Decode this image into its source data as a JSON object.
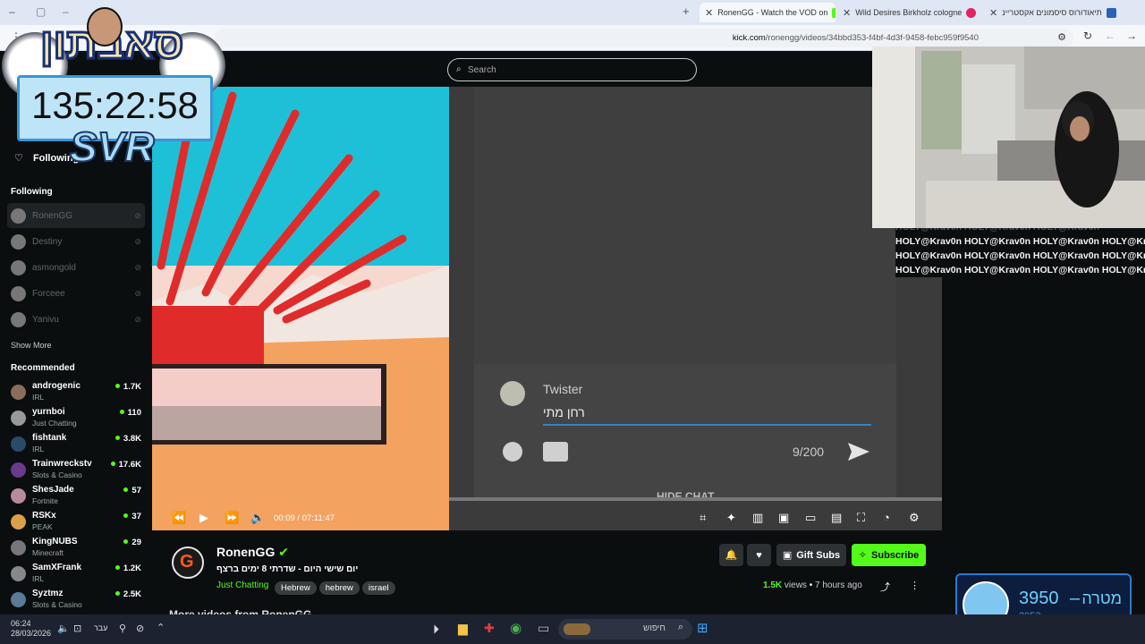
{
  "browser": {
    "tabs": [
      {
        "label": "RonenGG - Watch the VOD on",
        "active": true
      },
      {
        "label": "Wild Desires Birkholz cologne",
        "active": false
      },
      {
        "label": "תיאודורוס סיסמונים אקסטריינ",
        "active": false
      }
    ],
    "url_domain": "kick.com",
    "url_path": "/ronengg/videos/34bbd353-f4bf-4d3f-9458-febc959f9540"
  },
  "kick": {
    "search_placeholder": "Search",
    "following_label": "Following"
  },
  "sidebar": {
    "following_heading": "Following",
    "following": [
      {
        "name": "RonenGG",
        "active": true
      },
      {
        "name": "Destiny",
        "active": false
      },
      {
        "name": "asmongold",
        "active": false
      },
      {
        "name": "Forceee",
        "active": false
      },
      {
        "name": "Yanivu",
        "active": false
      }
    ],
    "show_more": "Show More",
    "recommended_heading": "Recommended",
    "recommended": [
      {
        "name": "androgenic",
        "category": "IRL",
        "viewers": "1.7K"
      },
      {
        "name": "yurnboi",
        "category": "Just Chatting",
        "viewers": "110"
      },
      {
        "name": "fishtank",
        "category": "IRL",
        "viewers": "3.8K"
      },
      {
        "name": "Trainwreckstv",
        "category": "Slots & Casino",
        "viewers": "17.6K"
      },
      {
        "name": "ShesJade",
        "category": "Fortnite",
        "viewers": "57"
      },
      {
        "name": "RSKx",
        "category": "PEAK",
        "viewers": "37"
      },
      {
        "name": "KingNUBS",
        "category": "Minecraft",
        "viewers": "29"
      },
      {
        "name": "SamXFrank",
        "category": "IRL",
        "viewers": "1.2K"
      },
      {
        "name": "Syztmz",
        "category": "Slots & Casino",
        "viewers": "2.5K"
      }
    ]
  },
  "video": {
    "chat_user": "Twister",
    "chat_text": "רחן מתי",
    "char_count": "9/200",
    "hide_chat": "HIDE CHAT",
    "time_current": "00:09",
    "time_total": "07:11:47"
  },
  "channel": {
    "name": "RonenGG",
    "title": "יום שישי היום - שדרתי 8 ימים ברצף",
    "category": "Just Chatting",
    "tags": [
      "Hebrew",
      "hebrew",
      "israel"
    ],
    "views": "1.5K",
    "views_label": "views",
    "age": "7 hours ago",
    "gift_subs": "Gift Subs",
    "subscribe": "Subscribe",
    "more_videos": "More videos from RonenGG"
  },
  "overlay": {
    "timer": "135:22:58",
    "svr": "SVR",
    "hebrew_title": "סאבתון",
    "chat_lines": [
      "HOLY@Krav0n HOLY@Krav0n HOLY@Krav0n",
      "HOLY@Krav0n HOLY@Krav0n HOLY@Krav0n HOLY@Krav0n",
      "HOLY@Krav0n HOLY@Krav0n HOLY@Krav0n HOLY@Krav0n",
      "HOLY@Krav0n HOLY@Krav0n HOLY@Krav0n HOLY@Krav0n"
    ],
    "goal_label": "מטרה",
    "goal_current": "3950",
    "goal_dash": "–",
    "goal_sub": "3953"
  },
  "taskbar": {
    "time": "06:24",
    "date": "28/03/2026",
    "lang": "עבר",
    "search_label": "חיפוש"
  },
  "colors": {
    "kick_green": "#53fc18",
    "background": "#0b0e0f",
    "timer_border": "#3a93d6"
  }
}
